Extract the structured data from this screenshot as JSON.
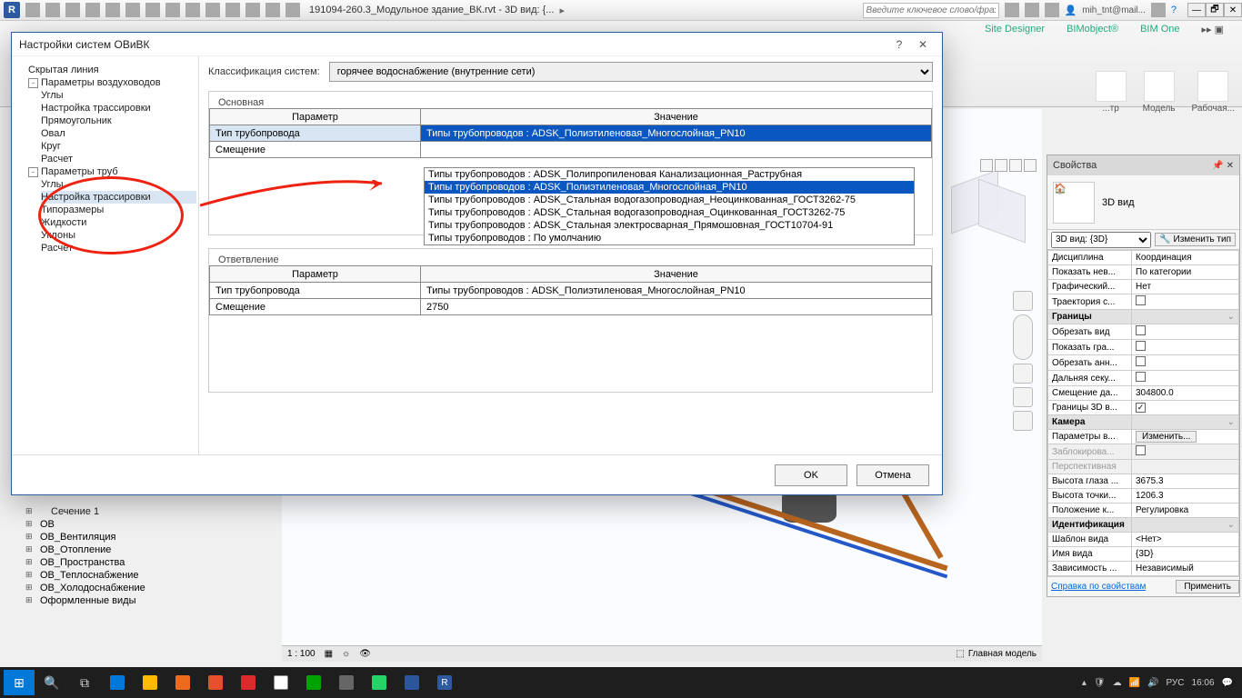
{
  "topbar": {
    "doc_title": "191094-260.3_Модульное здание_ВК.rvt - 3D вид: {...",
    "search_placeholder": "Введите ключевое слово/фразу",
    "user": "mih_tnt@mail..."
  },
  "ribbon": {
    "tabs": [
      "Site Designer",
      "BIMobject®",
      "BIM One"
    ],
    "items": [
      "...тр",
      "Модель",
      "Рабочая..."
    ]
  },
  "dialog": {
    "title": "Настройки систем ОВиВК",
    "tree": [
      {
        "lvl": 0,
        "t": "Скрытая линия"
      },
      {
        "lvl": 0,
        "t": "Параметры воздуховодов",
        "exp": "-"
      },
      {
        "lvl": 1,
        "t": "Углы"
      },
      {
        "lvl": 1,
        "t": "Настройка трассировки"
      },
      {
        "lvl": 1,
        "t": "Прямоугольник"
      },
      {
        "lvl": 1,
        "t": "Овал"
      },
      {
        "lvl": 1,
        "t": "Круг"
      },
      {
        "lvl": 1,
        "t": "Расчет"
      },
      {
        "lvl": 0,
        "t": "Параметры труб",
        "exp": "-"
      },
      {
        "lvl": 1,
        "t": "Углы"
      },
      {
        "lvl": 1,
        "t": "Настройка трассировки",
        "sel": true
      },
      {
        "lvl": 1,
        "t": "Типоразмеры"
      },
      {
        "lvl": 1,
        "t": "Жидкости"
      },
      {
        "lvl": 1,
        "t": "Уклоны"
      },
      {
        "lvl": 1,
        "t": "Расчет"
      }
    ],
    "class_label": "Классификация систем:",
    "class_value": "горячее водоснабжение (внутренние сети)",
    "section1": "Основная",
    "section2": "Ответвление",
    "col_param": "Параметр",
    "col_value": "Значение",
    "rows1": [
      {
        "p": "Тип трубопровода",
        "v": "Типы трубопроводов : ADSK_Полиэтиленовая_Многослойная_PN10",
        "selcell": true,
        "valsel": true
      },
      {
        "p": "Смещение",
        "v": ""
      }
    ],
    "rows2": [
      {
        "p": "Тип трубопровода",
        "v": "Типы трубопроводов : ADSK_Полиэтиленовая_Многослойная_PN10"
      },
      {
        "p": "Смещение",
        "v": "2750"
      }
    ],
    "dropdown": [
      {
        "t": "Типы трубопроводов : ADSK_Полипропиленовая Канализационная_Раструбная"
      },
      {
        "t": "Типы трубопроводов : ADSK_Полиэтиленовая_Многослойная_PN10",
        "sel": true
      },
      {
        "t": "Типы трубопроводов : ADSK_Стальная водогазопроводная_Неоцинкованная_ГОСТ3262-75"
      },
      {
        "t": "Типы трубопроводов : ADSK_Стальная водогазопроводная_Оцинкованная_ГОСТ3262-75"
      },
      {
        "t": "Типы трубопроводов : ADSK_Стальная электросварная_Прямошовная_ГОСТ10704-91"
      },
      {
        "t": "Типы трубопроводов : По умолчанию"
      }
    ],
    "ok": "OK",
    "cancel": "Отмена"
  },
  "props": {
    "title": "Свойства",
    "type_name": "3D вид",
    "view_sel": "3D вид: {3D}",
    "edit_type": "Изменить тип",
    "rows": [
      {
        "k": "Дисциплина",
        "v": "Координация"
      },
      {
        "k": "Показать нев...",
        "v": "По категории"
      },
      {
        "k": "Графический...",
        "v": "Нет"
      },
      {
        "k": "Траектория с...",
        "v": "",
        "chk": false
      },
      {
        "cat": "Границы"
      },
      {
        "k": "Обрезать вид",
        "v": "",
        "chk": false
      },
      {
        "k": "Показать гра...",
        "v": "",
        "chk": false
      },
      {
        "k": "Обрезать анн...",
        "v": "",
        "chk": false
      },
      {
        "k": "Дальняя секу...",
        "v": "",
        "chk": false
      },
      {
        "k": "Смещение да...",
        "v": "304800.0"
      },
      {
        "k": "Границы 3D в...",
        "v": "",
        "chk": true
      },
      {
        "cat": "Камера"
      },
      {
        "k": "Параметры в...",
        "v": "Изменить...",
        "btn": true
      },
      {
        "k": "Заблокирова...",
        "v": "",
        "chk": false,
        "dis": true
      },
      {
        "k": "Перспективная",
        "v": "",
        "dis": true
      },
      {
        "k": "Высота глаза ...",
        "v": "3675.3"
      },
      {
        "k": "Высота точки...",
        "v": "1206.3"
      },
      {
        "k": "Положение к...",
        "v": "Регулировка"
      },
      {
        "cat": "Идентификация"
      },
      {
        "k": "Шаблон вида",
        "v": "<Нет>"
      },
      {
        "k": "Имя вида",
        "v": "{3D}"
      },
      {
        "k": "Зависимость ...",
        "v": "Независимый"
      }
    ],
    "help": "Справка по свойствам",
    "apply": "Применить"
  },
  "browser": [
    "Сечение 1",
    "ОВ",
    "ОВ_Вентиляция",
    "ОВ_Отопление",
    "ОВ_Пространства",
    "ОВ_Теплоснабжение",
    "ОВ_Холодоснабжение",
    "Оформленные виды"
  ],
  "viewport": {
    "scale": "1 : 100",
    "status": "Главная модель"
  },
  "taskbar": {
    "lang": "РУС",
    "time": "16:06"
  }
}
